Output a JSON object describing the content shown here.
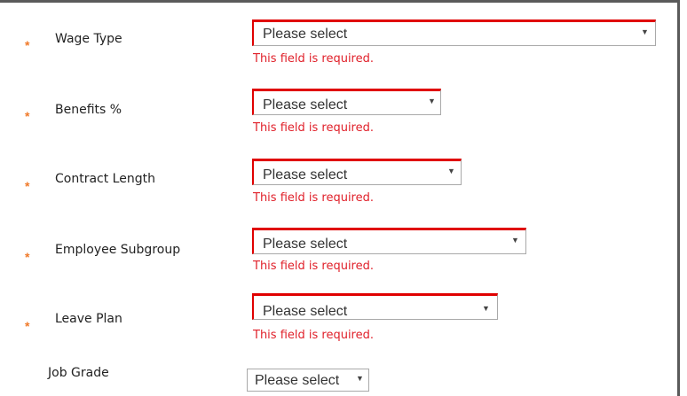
{
  "fields": [
    {
      "label": "Wage Type",
      "required_marker": "*",
      "value": "Please select",
      "error": "This field is required."
    },
    {
      "label": "Benefits %",
      "required_marker": "*",
      "value": "Please select",
      "error": "This field is required."
    },
    {
      "label": "Contract Length",
      "required_marker": "*",
      "value": "Please select",
      "error": "This field is required."
    },
    {
      "label": "Employee Subgroup",
      "required_marker": "*",
      "value": "Please select",
      "error": "This field is required."
    },
    {
      "label": "Leave Plan",
      "required_marker": "*",
      "value": "Please select",
      "error": "This field is required."
    },
    {
      "label": "Job Grade",
      "value": "Please select"
    }
  ],
  "icons": {
    "dropdown_arrow": "▼",
    "required": "asterisk"
  },
  "colors": {
    "required_marker": "#f07a2a",
    "error_text": "#e0202a",
    "error_border": "#e00000"
  }
}
